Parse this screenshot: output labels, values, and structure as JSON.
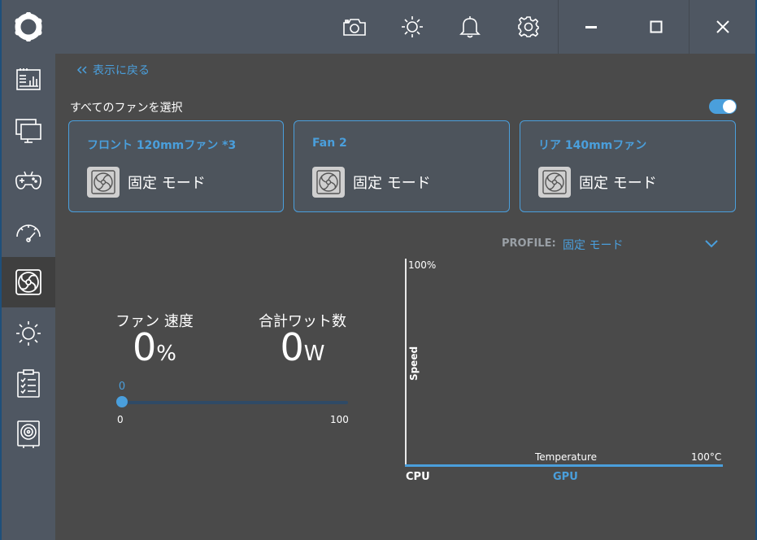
{
  "window": {
    "toolbar_icons": [
      "camera-icon",
      "brightness-icon",
      "bell-icon",
      "gear-icon"
    ],
    "controls": [
      "minimize-icon",
      "maximize-icon",
      "close-icon"
    ]
  },
  "sidebar": {
    "items": [
      {
        "icon": "dashboard-icon"
      },
      {
        "icon": "monitor-icon"
      },
      {
        "icon": "gamepad-icon"
      },
      {
        "icon": "speedometer-icon"
      },
      {
        "icon": "fan-icon",
        "active": true
      },
      {
        "icon": "lighting-icon"
      },
      {
        "icon": "checklist-icon"
      },
      {
        "icon": "storage-icon"
      }
    ]
  },
  "back_label": "表示に戻る",
  "select_all_label": "すべてのファンを選択",
  "select_all_enabled": true,
  "fans": [
    {
      "name": "フロント 120mmファン *3",
      "mode": "固定 モード"
    },
    {
      "name": "Fan 2",
      "mode": "固定 モード"
    },
    {
      "name": "リア 140mmファン",
      "mode": "固定 モード"
    }
  ],
  "profile": {
    "label": "PROFILE:",
    "value": "固定 モード"
  },
  "stats": {
    "fan_speed": {
      "label": "ファン 速度",
      "value": "0",
      "unit": "%"
    },
    "total_watts": {
      "label": "合計ワット数",
      "value": "0",
      "unit": "W"
    }
  },
  "slider": {
    "value": "0",
    "min": "0",
    "max": "100"
  },
  "chart_data": {
    "type": "line",
    "ylabel": "Speed",
    "xlabel": "Temperature",
    "y_max_label": "100%",
    "x_max_label": "100°C",
    "sources": [
      "CPU",
      "GPU"
    ],
    "active_source": "CPU"
  },
  "colors": {
    "accent": "#4a9fdc",
    "sidebar": "#4f5762",
    "background": "#4a4a4a"
  }
}
